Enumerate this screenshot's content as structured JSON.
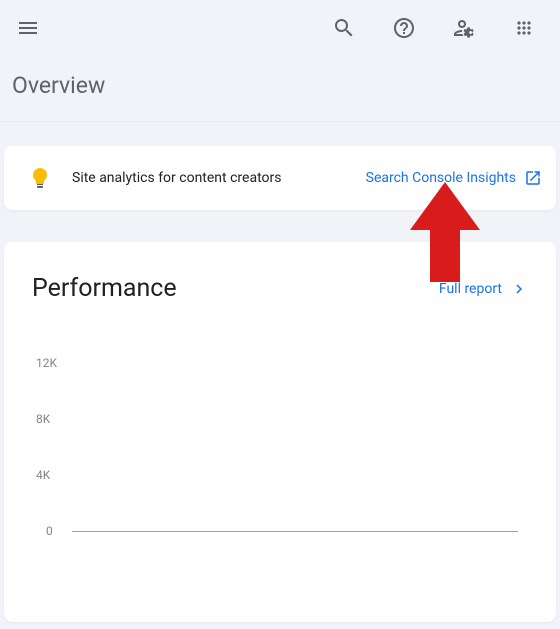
{
  "page": {
    "title": "Overview"
  },
  "banner": {
    "text": "Site analytics for content creators",
    "link_label": "Search Console Insights"
  },
  "performance": {
    "title": "Performance",
    "full_report_label": "Full report"
  },
  "chart_data": {
    "type": "line",
    "title": "Performance",
    "xlabel": "",
    "ylabel": "",
    "ylim": [
      0,
      12000
    ],
    "y_ticks": [
      "12K",
      "8K",
      "4K",
      "0"
    ],
    "categories": [],
    "values": []
  }
}
